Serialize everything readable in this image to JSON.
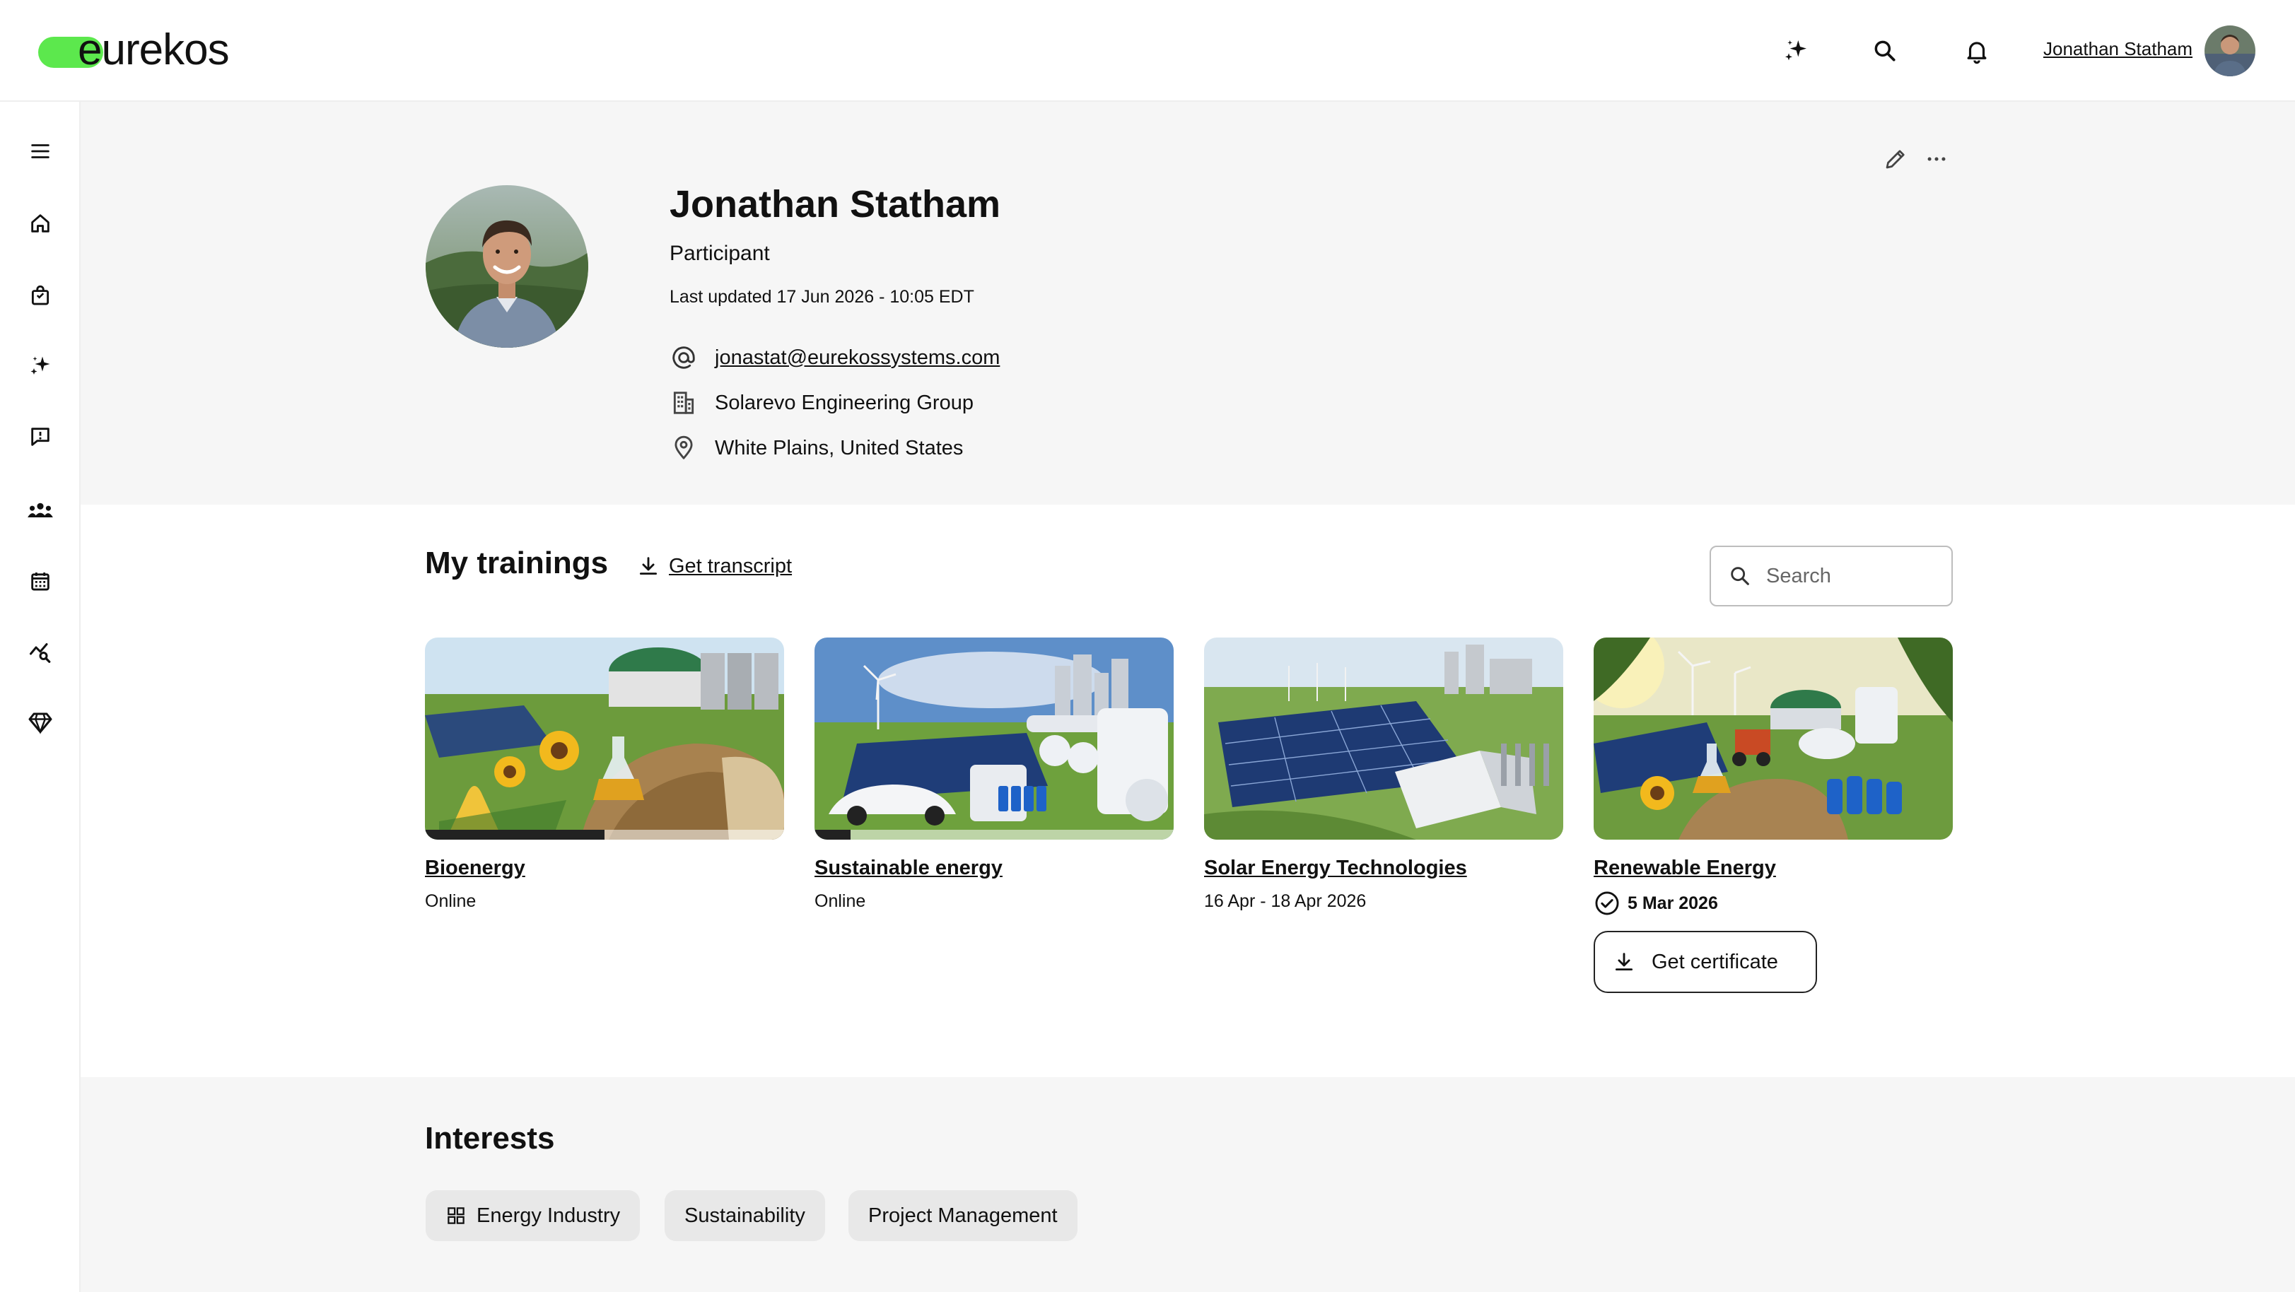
{
  "brand": {
    "logo_text": "eurekos",
    "accent": "#5ce84d"
  },
  "header": {
    "user_name": "Jonathan Statham",
    "icons": [
      "sparkle-icon",
      "search-icon",
      "bell-icon"
    ]
  },
  "sidebar": {
    "items": [
      "menu-icon",
      "home-icon",
      "bag-icon",
      "sparkle-icon",
      "feedback-icon",
      "group-icon",
      "calendar-icon",
      "analytics-icon",
      "diamond-icon"
    ]
  },
  "profile": {
    "name": "Jonathan Statham",
    "role": "Participant",
    "last_updated": "Last updated 17 Jun 2026 - 10:05 EDT",
    "email": "jonastat@eurekossystems.com",
    "company": "Solarevo Engineering Group",
    "location": "White Plains, United States"
  },
  "trainings": {
    "title": "My trainings",
    "transcript_label": "Get transcript",
    "search_placeholder": "Search",
    "cards": [
      {
        "title": "Bioenergy",
        "subtitle": "Online",
        "progress": 0.5
      },
      {
        "title": "Sustainable energy",
        "subtitle": "Online",
        "progress": 0.1
      },
      {
        "title": "Solar Energy Technologies",
        "subtitle": "16 Apr - 18 Apr 2026"
      },
      {
        "title": "Renewable Energy",
        "completed_date": "5 Mar 2026",
        "certificate_label": "Get certificate"
      }
    ]
  },
  "interests": {
    "title": "Interests",
    "chips": [
      "Energy Industry",
      "Sustainability",
      "Project Management"
    ]
  }
}
